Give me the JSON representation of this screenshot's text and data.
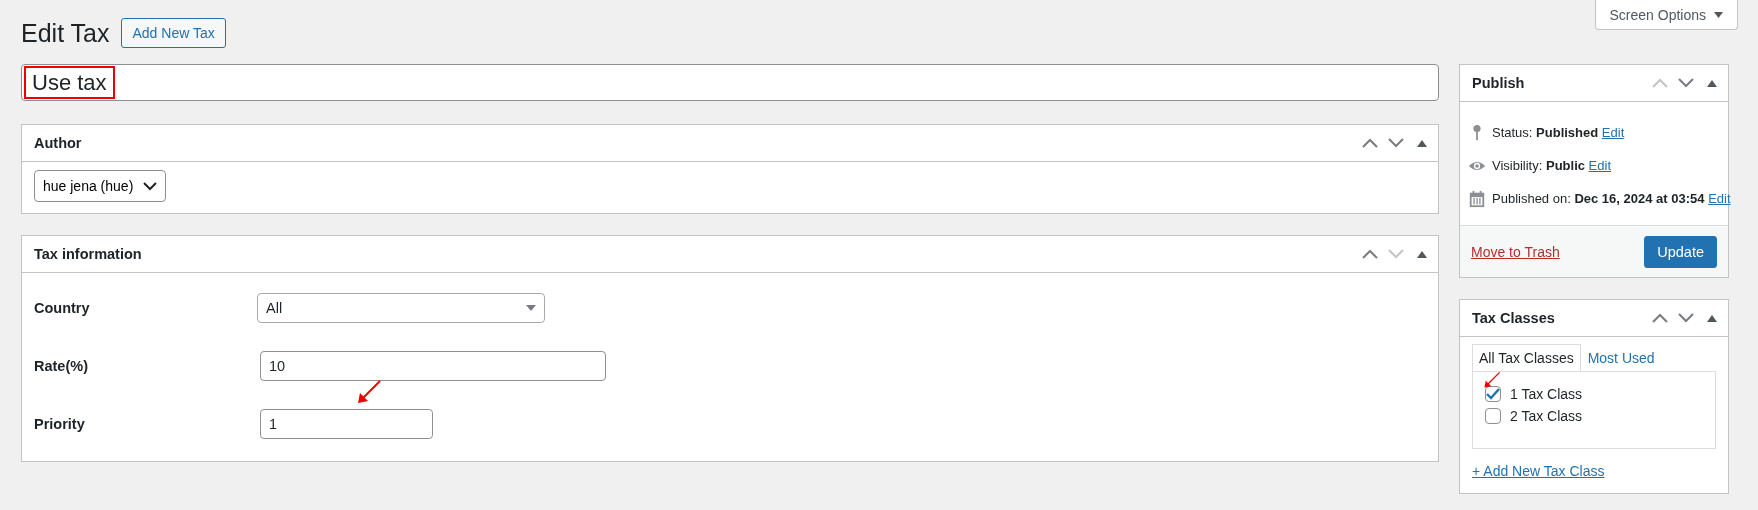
{
  "header": {
    "title": "Edit Tax",
    "add_button": "Add New Tax",
    "screen_options": "Screen Options"
  },
  "post_title": {
    "value": "Use tax",
    "highlighted": true
  },
  "author_box": {
    "title": "Author",
    "up_disabled": false,
    "down_disabled": false,
    "author": "hue jena (hue)"
  },
  "tax_info_box": {
    "title": "Tax information",
    "up_disabled": false,
    "down_disabled": true,
    "fields": [
      {
        "label": "Country",
        "kind": "select",
        "value": "All"
      },
      {
        "label": "Rate(%)",
        "kind": "text",
        "value": "10"
      },
      {
        "label": "Priority",
        "kind": "text",
        "value": "1"
      }
    ]
  },
  "publish_box": {
    "title": "Publish",
    "up_disabled": true,
    "down_disabled": false,
    "rows": [
      {
        "kind": "status",
        "label": "Status:",
        "value": "Published",
        "link": "Edit"
      },
      {
        "kind": "visibility",
        "label": "Visibility:",
        "value": "Public",
        "link": "Edit"
      },
      {
        "kind": "date",
        "label": "Published on:",
        "value": "Dec 16, 2024 at 03:54",
        "link": "Edit"
      }
    ],
    "trash": "Move to Trash",
    "update": "Update"
  },
  "tax_classes_box": {
    "title": "Tax Classes",
    "up_disabled": false,
    "down_disabled": false,
    "tabs": [
      {
        "label": "All Tax Classes",
        "selected": true
      },
      {
        "label": "Most Used",
        "selected": false
      }
    ],
    "classes": [
      {
        "label": "1 Tax Class",
        "checked": true
      },
      {
        "label": "2 Tax Class",
        "checked": false
      }
    ],
    "add_link": "+ Add New Tax Class"
  }
}
